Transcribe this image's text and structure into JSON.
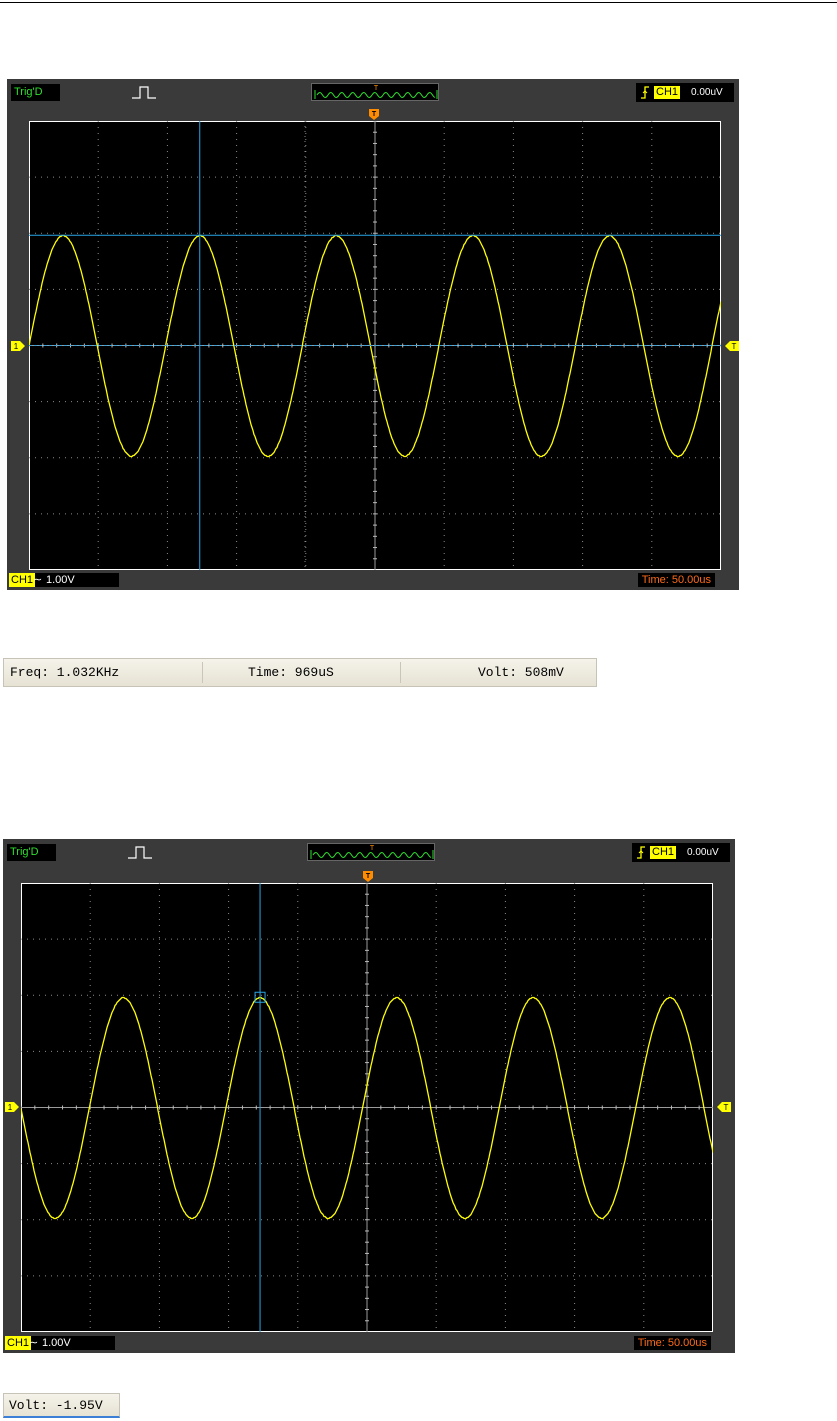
{
  "scopes": [
    {
      "trig_status": "Trig'D",
      "channel": "CH1",
      "trigger_level": "0.00uV",
      "trigger_marker": "T",
      "channel_marker": "1",
      "coupling_symbol": "∼",
      "volts_per_div": "1.00V",
      "time_per_div": "Time: 50.00us",
      "cursor_mode": "cross",
      "icons": [
        "pulse-icon",
        "rising-edge-icon"
      ]
    },
    {
      "trig_status": "Trig'D",
      "channel": "CH1",
      "trigger_level": "0.00uV",
      "trigger_marker": "T",
      "channel_marker": "1",
      "coupling_symbol": "∼",
      "volts_per_div": "1.00V",
      "time_per_div": "Time: 50.00us",
      "cursor_mode": "track",
      "icons": [
        "pulse-icon",
        "rising-edge-icon"
      ]
    }
  ],
  "measurement_bar": {
    "freq": "Freq: 1.032KHz",
    "time": "Time: 969uS",
    "volt": "Volt: 508mV"
  },
  "measurement_bar_2": {
    "volt": "Volt: -1.95V"
  },
  "colors": {
    "trace": "#ffff00",
    "cursor": "#2aa6e6",
    "trig_label": "#2ee02e",
    "marker": "#ff8c00",
    "time_text": "#ff6a1a"
  }
}
